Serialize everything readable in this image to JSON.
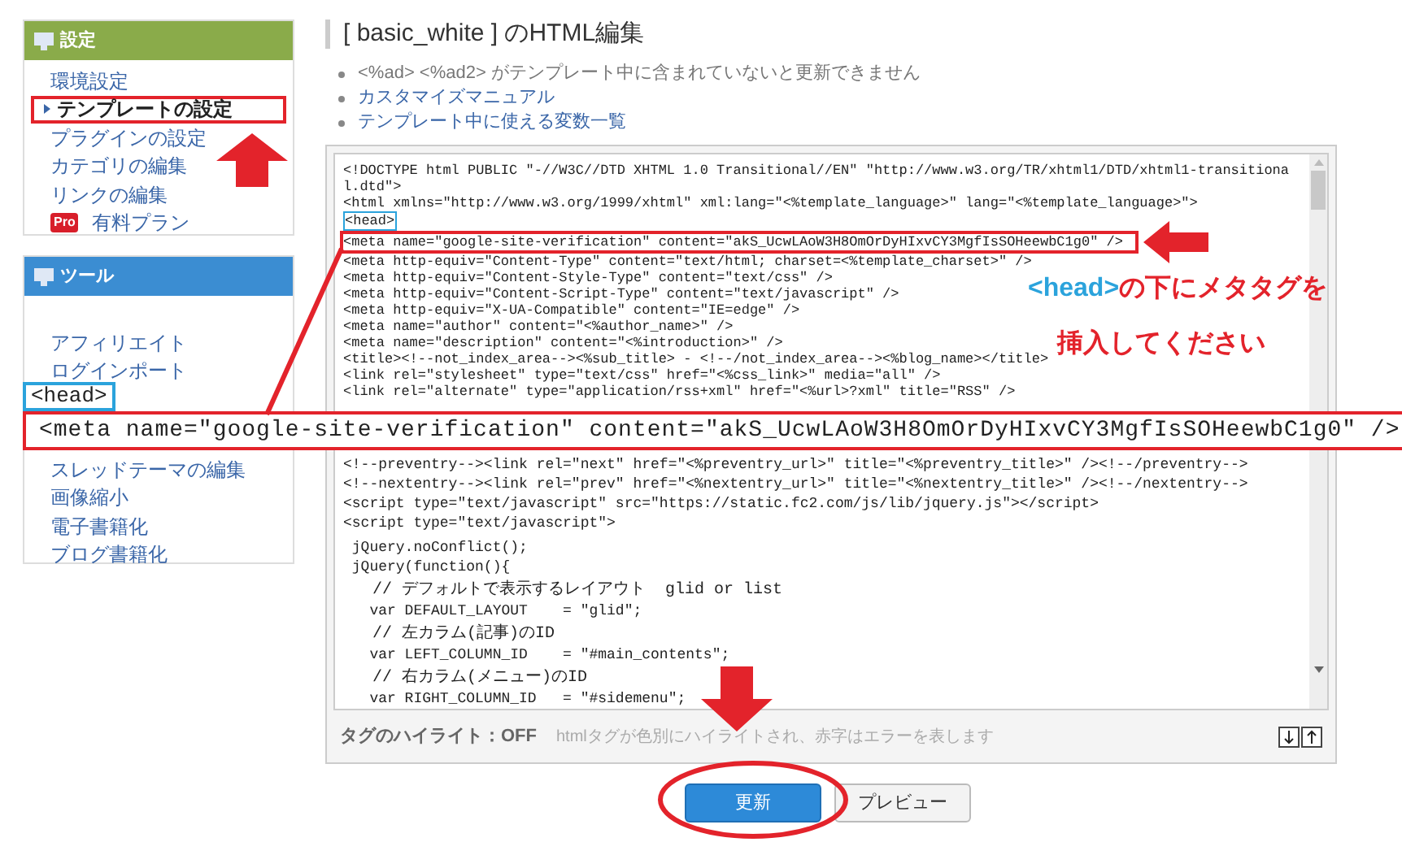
{
  "sidebar": {
    "panels": [
      {
        "title": "設定",
        "kind": "settings",
        "items": [
          {
            "label": "環境設定",
            "kind": "link",
            "selected": false
          },
          {
            "label": "テンプレートの設定",
            "kind": "link",
            "selected": true
          },
          {
            "label": "プラグインの設定",
            "kind": "link",
            "selected": false
          },
          {
            "label": "カテゴリの編集",
            "kind": "link",
            "selected": false
          },
          {
            "label": "リンクの編集",
            "kind": "link",
            "selected": false
          },
          {
            "label": "有料プラン",
            "kind": "pro",
            "badge": "Pro",
            "selected": false
          }
        ]
      },
      {
        "title": "ツール",
        "kind": "tools",
        "items": [
          {
            "label": "アフィリエイト",
            "kind": "link",
            "selected": false
          },
          {
            "label": "ログインポート",
            "kind": "link",
            "selected": false
          }
        ],
        "items_after_gap": [
          {
            "label": "スレッドテーマの編集",
            "kind": "link",
            "selected": false
          },
          {
            "label": "画像縮小",
            "kind": "link",
            "selected": false
          },
          {
            "label": "電子書籍化",
            "kind": "link",
            "selected": false
          },
          {
            "label": "ブログ書籍化",
            "kind": "link",
            "selected": false
          }
        ]
      }
    ]
  },
  "page_title": "[ basic_white ] のHTML編集",
  "notes": [
    {
      "text": "<%ad> <%ad2> がテンプレート中に含まれていないと更新できません",
      "kind": "note"
    },
    {
      "text": "カスタマイズマニュアル",
      "kind": "link"
    },
    {
      "text": "テンプレート中に使える変数一覧",
      "kind": "link"
    }
  ],
  "editor": {
    "top_lines": [
      {
        "kind": "code",
        "text": "<!DOCTYPE html PUBLIC \"-//W3C//DTD XHTML 1.0 Transitional//EN\" \"http://www.w3.org/TR/xhtml1/DTD/xhtml1-transitiona"
      },
      {
        "kind": "code",
        "text": "l.dtd\">"
      },
      {
        "kind": "code",
        "text": "<html xmlns=\"http://www.w3.org/1999/xhtml\" xml:lang=\"<%template_language>\" lang=\"<%template_language>\">"
      },
      {
        "kind": "head",
        "text": "<head>"
      },
      {
        "kind": "meta",
        "text": "<meta name=\"google-site-verification\" content=\"akS_UcwLAoW3H8OmOrDyHIxvCY3MgfIsSOHeewbC1g0\" />"
      },
      {
        "kind": "code",
        "text": "<meta http-equiv=\"Content-Type\" content=\"text/html; charset=<%template_charset>\" />"
      },
      {
        "kind": "code",
        "text": "<meta http-equiv=\"Content-Style-Type\" content=\"text/css\" />"
      },
      {
        "kind": "code",
        "text": "<meta http-equiv=\"Content-Script-Type\" content=\"text/javascript\" />"
      },
      {
        "kind": "code",
        "text": "<meta http-equiv=\"X-UA-Compatible\" content=\"IE=edge\" />"
      },
      {
        "kind": "code",
        "text": "<meta name=\"author\" content=\"<%author_name>\" />"
      },
      {
        "kind": "code",
        "text": "<meta name=\"description\" content=\"<%introduction>\" />"
      },
      {
        "kind": "code",
        "text": "<title><!--not_index_area--><%sub_title> - <!--/not_index_area--><%blog_name></title>"
      },
      {
        "kind": "code",
        "text": "<link rel=\"stylesheet\" type=\"text/css\" href=\"<%css_link>\" media=\"all\" />"
      },
      {
        "kind": "code",
        "text": "<link rel=\"alternate\" type=\"application/rss+xml\" href=\"<%url>?xml\" title=\"RSS\" />"
      }
    ],
    "bottom_lines": [
      {
        "kind": "code",
        "text": "<!--preventry--><link rel=\"next\" href=\"<%preventry_url>\" title=\"<%preventry_title>\" /><!--/preventry-->"
      },
      {
        "kind": "code",
        "text": "<!--nextentry--><link rel=\"prev\" href=\"<%nextentry_url>\" title=\"<%nextentry_title>\" /><!--/nextentry-->"
      },
      {
        "kind": "code",
        "text": "<script type=\"text/javascript\" src=\"https://static.fc2.com/js/lib/jquery.js\"></script>"
      },
      {
        "kind": "code",
        "text": "<script type=\"text/javascript\">"
      },
      {
        "kind": "blank"
      },
      {
        "kind": "code",
        "text": " jQuery.noConflict();"
      },
      {
        "kind": "code",
        "text": " jQuery(function(){"
      },
      {
        "kind": "blank"
      },
      {
        "kind": "comment",
        "text": "   // デフォルトで表示するレイアウト  glid or list"
      },
      {
        "kind": "code",
        "text": "   var DEFAULT_LAYOUT    = \"glid\";"
      },
      {
        "kind": "blank"
      },
      {
        "kind": "comment",
        "text": "   // 左カラム(記事)のID"
      },
      {
        "kind": "code",
        "text": "   var LEFT_COLUMN_ID    = \"#main_contents\";"
      },
      {
        "kind": "blank"
      },
      {
        "kind": "comment",
        "text": "   // 右カラム(メニュー)のID"
      },
      {
        "kind": "code",
        "text": "   var RIGHT_COLUMN_ID   = \"#sidemenu\";"
      }
    ],
    "highlight_label": "タグのハイライト：OFF",
    "highlight_hint": "htmlタグが色別にハイライトされ、赤字はエラーを表します"
  },
  "buttons": [
    {
      "label": "更新",
      "kind": "primary"
    },
    {
      "label": "プレビュー",
      "kind": "secondary"
    }
  ],
  "callout": {
    "head": "<head>",
    "meta": "<meta name=\"google-site-verification\" content=\"akS_UcwLAoW3H8OmOrDyHIxvCY3MgfIsSOHeewbC1g0\" />",
    "message": [
      [
        {
          "text": "<head>",
          "color": "#2ba3dc"
        },
        {
          "text": "の下にメタタグを",
          "color": "#e3232b"
        }
      ],
      [
        {
          "text": "挿入してください",
          "color": "#e3232b"
        }
      ]
    ]
  }
}
